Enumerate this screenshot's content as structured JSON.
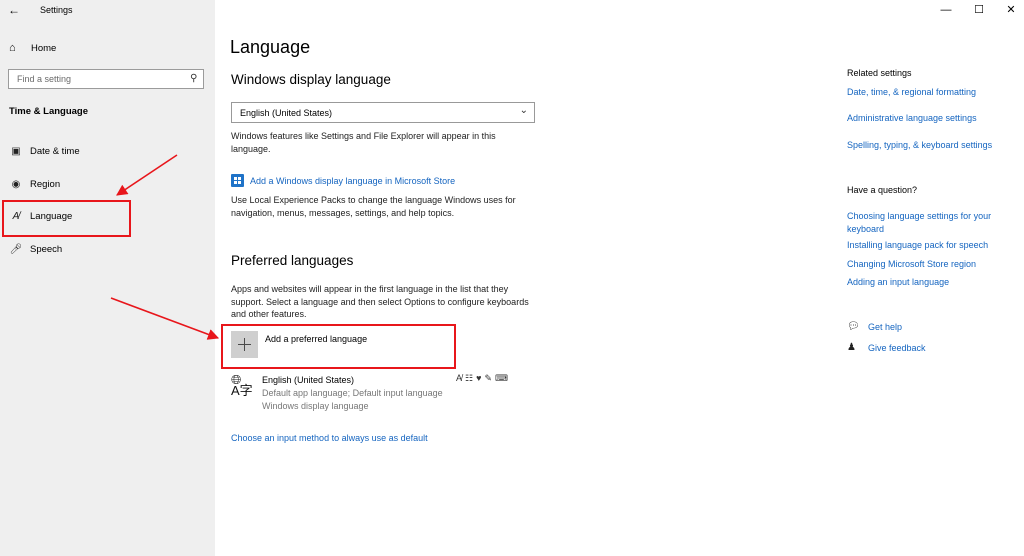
{
  "window": {
    "title": "Settings",
    "back_icon": "back-arrow-icon",
    "controls": [
      "—",
      "☐",
      "✕"
    ]
  },
  "sidebar": {
    "home_label": "Home",
    "search_placeholder": "Find a setting",
    "section_title": "Time & Language",
    "items": [
      {
        "label": "Date & time",
        "icon": "calendar-clock-icon"
      },
      {
        "label": "Region",
        "icon": "globe-icon"
      },
      {
        "label": "Language",
        "icon": "language-icon"
      },
      {
        "label": "Speech",
        "icon": "microphone-icon"
      }
    ]
  },
  "main": {
    "title": "Language",
    "display_language": {
      "heading": "Windows display language",
      "selected": "English (United States)",
      "description": "Windows features like Settings and File Explorer will appear in this language.",
      "store_link": "Add a Windows display language in Microsoft Store",
      "store_description": "Use Local Experience Packs to change the language Windows uses for navigation, menus, messages, settings, and help topics."
    },
    "preferred": {
      "heading": "Preferred languages",
      "description": "Apps and websites will appear in the first language in the list that they support. Select a language and then select Options to configure keyboards and other features.",
      "add_label": "Add a preferred language",
      "languages": [
        {
          "name": "English (United States)",
          "line1": "Default app language; Default input language",
          "line2": "Windows display language"
        }
      ]
    },
    "input_method_link": "Choose an input method to always use as default"
  },
  "related": {
    "heading": "Related settings",
    "links": [
      "Date, time, & regional formatting",
      "Administrative language settings",
      "Spelling, typing, & keyboard settings"
    ]
  },
  "question": {
    "heading": "Have a question?",
    "links": [
      "Choosing language settings for your keyboard",
      "Installing language pack for speech",
      "Changing Microsoft Store region",
      "Adding an input language"
    ]
  },
  "help": {
    "get_help": "Get help",
    "feedback": "Give feedback"
  },
  "annotations": {
    "color": "#e8161b"
  }
}
